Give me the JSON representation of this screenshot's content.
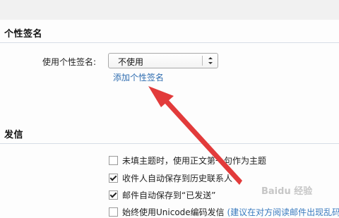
{
  "signature_section": {
    "title": "个性签名",
    "field_label": "使用个性签名:",
    "select_value": "不使用",
    "add_link": "添加个性签名"
  },
  "sending_section": {
    "title": "发信",
    "options": [
      {
        "label": "未填主题时，使用正文第一句作为主题",
        "checked": false
      },
      {
        "label": "收件人自动保存到历史联系人",
        "checked": true
      },
      {
        "label": "邮件自动保存到“已发送”",
        "checked": true
      },
      {
        "label": "始终使用Unicode编码发信",
        "checked": false,
        "hint": "(建议在对方阅读邮件出现乱码时"
      }
    ]
  },
  "colors": {
    "link": "#2f6db0",
    "annotation_arrow": "#e23b3b",
    "divider": "#d6dde6"
  },
  "watermark": "Baidu 经验"
}
